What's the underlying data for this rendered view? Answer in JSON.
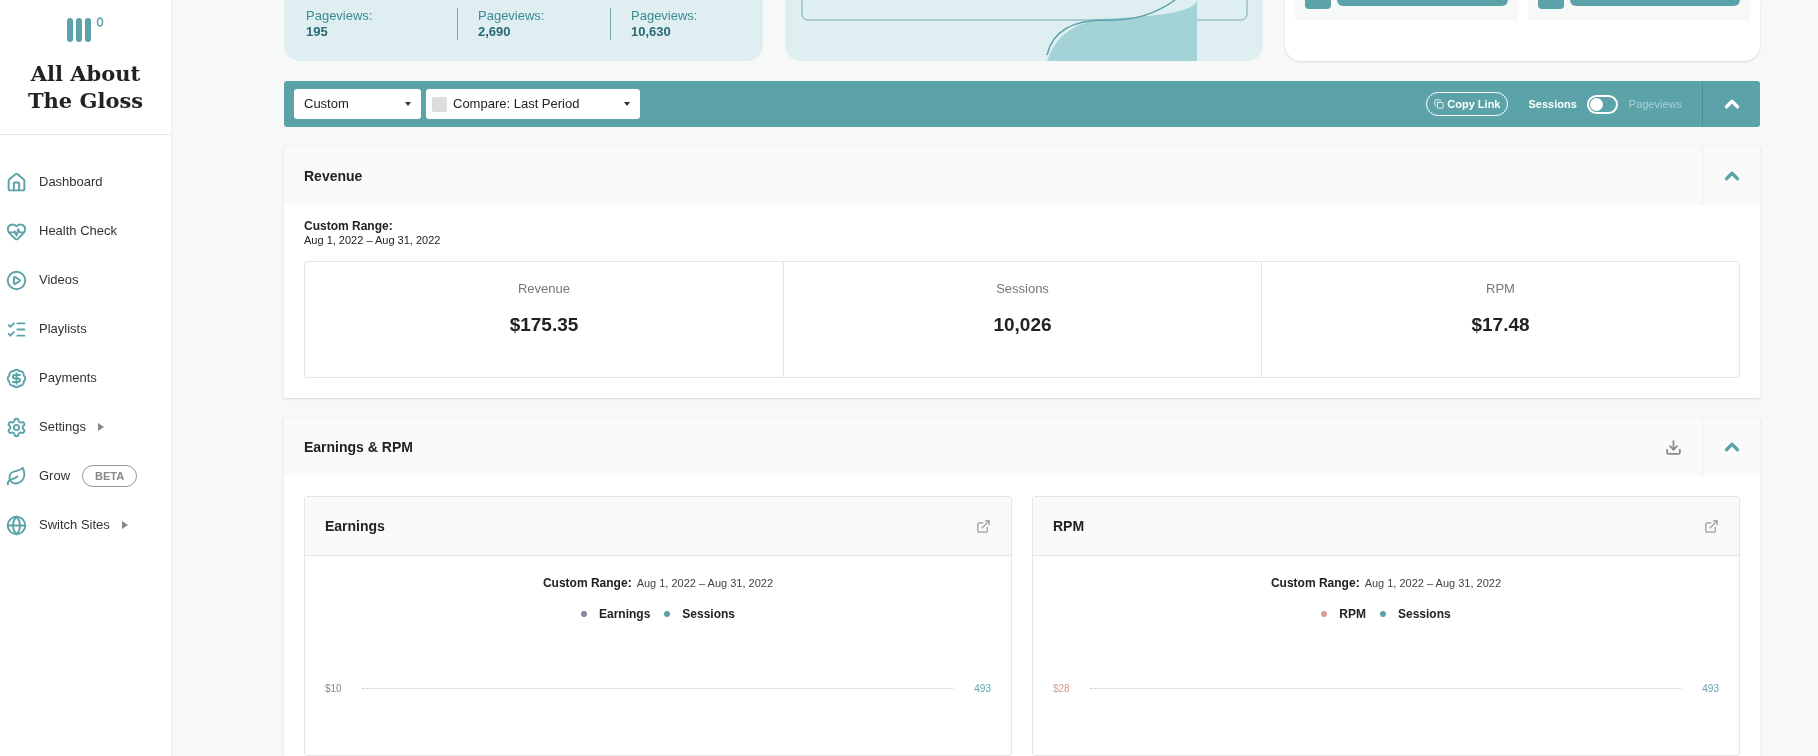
{
  "sidebar": {
    "site_title": "All About The Gloss",
    "items": [
      {
        "label": "Dashboard",
        "kind": "link"
      },
      {
        "label": "Health Check",
        "kind": "link"
      },
      {
        "label": "Videos",
        "kind": "link"
      },
      {
        "label": "Playlists",
        "kind": "link"
      },
      {
        "label": "Payments",
        "kind": "link"
      },
      {
        "label": "Settings",
        "kind": "submenu"
      },
      {
        "label": "Grow",
        "kind": "link",
        "badge": "BETA"
      },
      {
        "label": "Switch Sites",
        "kind": "submenu"
      }
    ]
  },
  "top_stats": [
    {
      "label": "Pageviews:",
      "value": "195"
    },
    {
      "label": "Pageviews:",
      "value": "2,690"
    },
    {
      "label": "Pageviews:",
      "value": "10,630"
    }
  ],
  "filter_bar": {
    "range": "Custom",
    "compare": "Compare: Last Period",
    "copy_link": "Copy Link",
    "metric_switch": {
      "left": "Sessions",
      "right": "Pageviews",
      "on": false
    }
  },
  "revenue": {
    "title": "Revenue",
    "range_label": "Custom Range:",
    "range": "Aug 1, 2022 – Aug 31, 2022",
    "metrics": [
      {
        "label": "Revenue",
        "value": "$175.35"
      },
      {
        "label": "Sessions",
        "value": "10,026"
      },
      {
        "label": "RPM",
        "value": "$17.48"
      }
    ]
  },
  "earnings_rpm": {
    "title": "Earnings & RPM",
    "charts": [
      {
        "title": "Earnings",
        "range_label": "Custom Range:",
        "range": "Aug 1, 2022 – Aug 31, 2022",
        "legend": [
          {
            "label": "Earnings",
            "color": "#8a8499"
          },
          {
            "label": "Sessions",
            "color": "#5ba3a8"
          }
        ],
        "left_tick": "$10",
        "right_tick": "493"
      },
      {
        "title": "RPM",
        "range_label": "Custom Range:",
        "range": "Aug 1, 2022 – Aug 31, 2022",
        "legend": [
          {
            "label": "RPM",
            "color": "#d89a95"
          },
          {
            "label": "Sessions",
            "color": "#5ba3a8"
          }
        ],
        "left_tick": "$28",
        "right_tick": "493"
      }
    ]
  }
}
